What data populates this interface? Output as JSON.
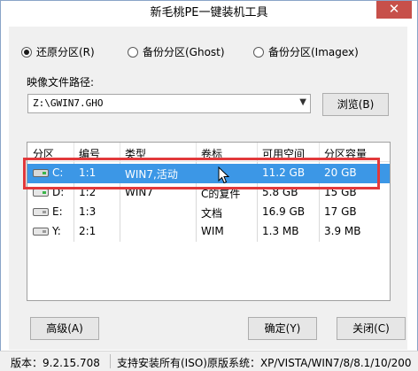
{
  "window": {
    "title": "新毛桃PE一键装机工具",
    "close_glyph": "✕"
  },
  "mode": {
    "options": [
      {
        "label": "还原分区(R)",
        "checked": true
      },
      {
        "label": "备份分区(Ghost)",
        "checked": false
      },
      {
        "label": "备份分区(Imagex)",
        "checked": false
      }
    ]
  },
  "image_path": {
    "label": "映像文件路径:",
    "value": "Z:\\GWIN7.GHO",
    "browse_label": "浏览(B)"
  },
  "table": {
    "headers": [
      "分区",
      "编号",
      "类型",
      "卷标",
      "可用空间",
      "分区容量"
    ],
    "rows": [
      {
        "drive": "C:",
        "num": "1:1",
        "type": "WIN7,活动",
        "label": "",
        "free": "11.2 GB",
        "size": "20 GB",
        "selected": true
      },
      {
        "drive": "D:",
        "num": "1:2",
        "type": "WIN7",
        "label": "C的复件",
        "free": "5.8 GB",
        "size": "15 GB",
        "selected": false
      },
      {
        "drive": "E:",
        "num": "1:3",
        "type": "",
        "label": "文档",
        "free": "16.9 GB",
        "size": "17 GB",
        "selected": false
      },
      {
        "drive": "Y:",
        "num": "2:1",
        "type": "",
        "label": "WIM",
        "free": "1.3 MB",
        "size": "3.9 MB",
        "selected": false
      }
    ]
  },
  "buttons": {
    "advanced": "高级(A)",
    "ok": "确定(Y)",
    "close": "关闭(C)"
  },
  "status": {
    "version": "版本：9.2.15.708",
    "support": "支持安装所有(ISO)原版系统：XP/VISTA/WIN7/8/8.1/10/200"
  },
  "colors": {
    "selection": "#3c97e6",
    "highlight": "#e2393b",
    "close": "#c7504a"
  }
}
